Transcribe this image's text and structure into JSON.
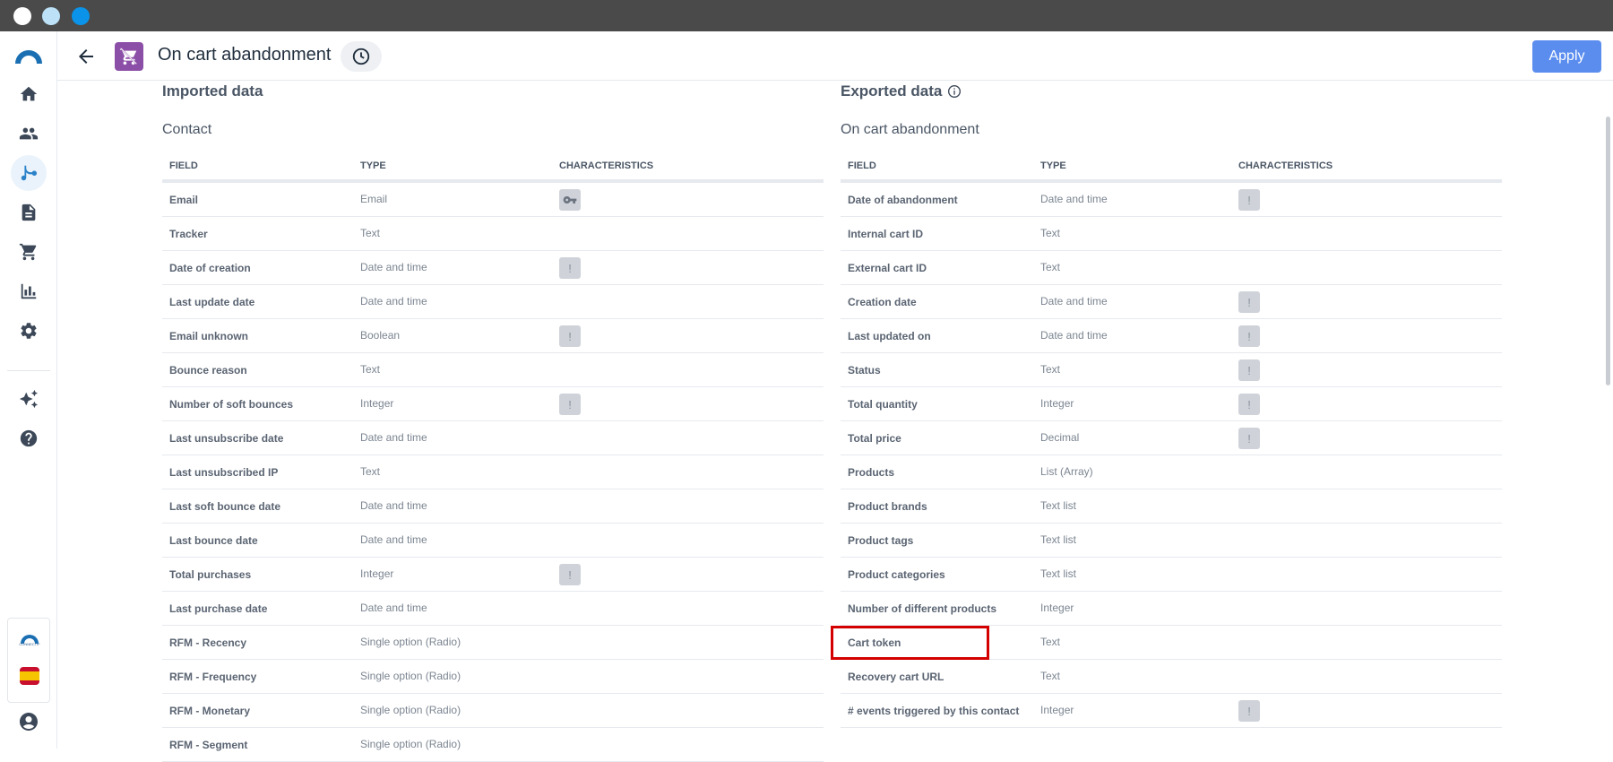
{
  "header": {
    "title": "On cart abandonment",
    "apply_label": "Apply"
  },
  "sidebar": {
    "brand_mini_text": "CONNECTIF",
    "items": [
      {
        "icon": "home-icon"
      },
      {
        "icon": "people-icon"
      },
      {
        "icon": "workflow-icon",
        "active": true
      },
      {
        "icon": "document-icon"
      },
      {
        "icon": "cart-icon"
      },
      {
        "icon": "bar-chart-icon"
      },
      {
        "icon": "gear-icon"
      },
      {
        "icon": "sparkle-icon"
      },
      {
        "icon": "help-icon"
      }
    ]
  },
  "imported": {
    "title": "Imported data",
    "subtitle": "Contact",
    "columns": {
      "field": "FIELD",
      "type": "TYPE",
      "characteristics": "CHARACTERISTICS"
    },
    "rows": [
      {
        "field": "Email",
        "type": "Email",
        "badge": "key"
      },
      {
        "field": "Tracker",
        "type": "Text",
        "badge": ""
      },
      {
        "field": "Date of creation",
        "type": "Date and time",
        "badge": "!"
      },
      {
        "field": "Last update date",
        "type": "Date and time",
        "badge": ""
      },
      {
        "field": "Email unknown",
        "type": "Boolean",
        "badge": "!"
      },
      {
        "field": "Bounce reason",
        "type": "Text",
        "badge": ""
      },
      {
        "field": "Number of soft bounces",
        "type": "Integer",
        "badge": "!"
      },
      {
        "field": "Last unsubscribe date",
        "type": "Date and time",
        "badge": ""
      },
      {
        "field": "Last unsubscribed IP",
        "type": "Text",
        "badge": ""
      },
      {
        "field": "Last soft bounce date",
        "type": "Date and time",
        "badge": ""
      },
      {
        "field": "Last bounce date",
        "type": "Date and time",
        "badge": ""
      },
      {
        "field": "Total purchases",
        "type": "Integer",
        "badge": "!"
      },
      {
        "field": "Last purchase date",
        "type": "Date and time",
        "badge": ""
      },
      {
        "field": "RFM - Recency",
        "type": "Single option (Radio)",
        "badge": ""
      },
      {
        "field": "RFM - Frequency",
        "type": "Single option (Radio)",
        "badge": ""
      },
      {
        "field": "RFM - Monetary",
        "type": "Single option (Radio)",
        "badge": ""
      },
      {
        "field": "RFM - Segment",
        "type": "Single option (Radio)",
        "badge": ""
      }
    ]
  },
  "exported": {
    "title": "Exported data",
    "subtitle": "On cart abandonment",
    "columns": {
      "field": "FIELD",
      "type": "TYPE",
      "characteristics": "CHARACTERISTICS"
    },
    "rows": [
      {
        "field": "Date of abandonment",
        "type": "Date and time",
        "badge": "!"
      },
      {
        "field": "Internal cart ID",
        "type": "Text",
        "badge": ""
      },
      {
        "field": "External cart ID",
        "type": "Text",
        "badge": ""
      },
      {
        "field": "Creation date",
        "type": "Date and time",
        "badge": "!"
      },
      {
        "field": "Last updated on",
        "type": "Date and time",
        "badge": "!"
      },
      {
        "field": "Status",
        "type": "Text",
        "badge": "!"
      },
      {
        "field": "Total quantity",
        "type": "Integer",
        "badge": "!"
      },
      {
        "field": "Total price",
        "type": "Decimal",
        "badge": "!"
      },
      {
        "field": "Products",
        "type": "List (Array)",
        "badge": ""
      },
      {
        "field": "Product brands",
        "type": "Text list",
        "badge": ""
      },
      {
        "field": "Product tags",
        "type": "Text list",
        "badge": ""
      },
      {
        "field": "Product categories",
        "type": "Text list",
        "badge": ""
      },
      {
        "field": "Number of different products",
        "type": "Integer",
        "badge": ""
      },
      {
        "field": "Cart token",
        "type": "Text",
        "badge": ""
      },
      {
        "field": "Recovery cart URL",
        "type": "Text",
        "badge": ""
      },
      {
        "field": "# events triggered by this contact",
        "type": "Integer",
        "badge": "!"
      }
    ]
  }
}
